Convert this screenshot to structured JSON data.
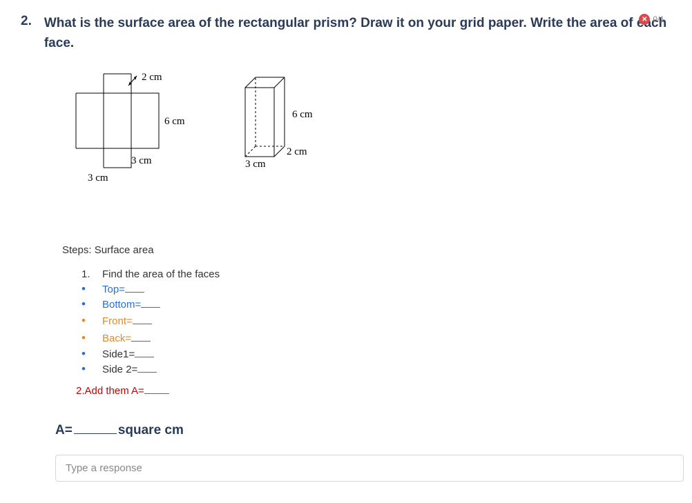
{
  "question": {
    "number": "2.",
    "text": "What is the surface area of the rectangular prism? Draw it on your grid paper. Write the area of each face."
  },
  "badge": {
    "icon": "✕",
    "score": "0/1"
  },
  "net": {
    "dim_top": "2 cm",
    "dim_right": "6 cm",
    "dim_mid": "3 cm",
    "dim_bottom": "3 cm"
  },
  "prism": {
    "height": "6 cm",
    "depth": "2 cm",
    "width": "3 cm"
  },
  "steps": {
    "title": "Steps: Surface area",
    "step1_num": "1.",
    "step1_text": "Find the area of the faces",
    "items": {
      "top": "Top=",
      "bottom": "Bottom=",
      "front": "Front=",
      "back": "Back=",
      "side1": "Side1=",
      "side2": "Side 2="
    },
    "step2": "2.Add them A="
  },
  "answer": {
    "prefix": "A=",
    "suffix": "square cm"
  },
  "input": {
    "placeholder": "Type a response"
  }
}
